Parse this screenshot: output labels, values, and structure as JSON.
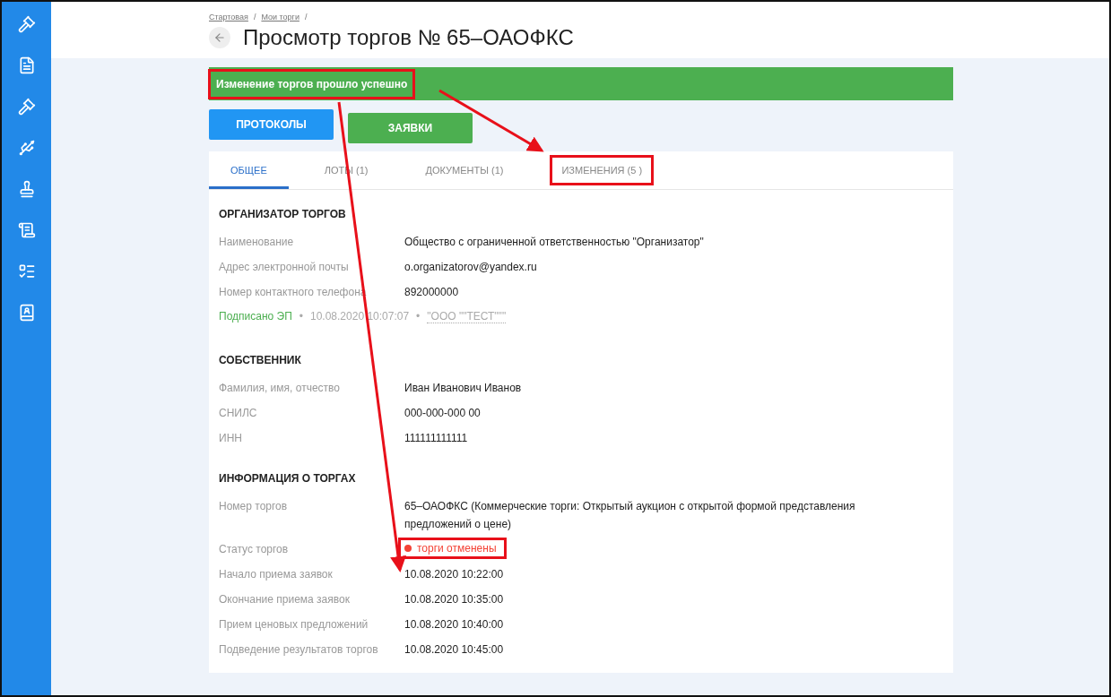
{
  "breadcrumbs": [
    {
      "label": "Стартовая",
      "separator": "/"
    },
    {
      "label": "Мои торги",
      "separator": "/"
    }
  ],
  "title": "Просмотр торгов № 65–ОАОФКС",
  "banner": {
    "text": "Изменение торгов прошло успешно",
    "highlighted": true
  },
  "buttons": [
    {
      "label": "ПРОТОКОЛЫ",
      "kind": "primary"
    },
    {
      "label": "ЗАЯВКИ",
      "kind": "success"
    }
  ],
  "tabs": [
    {
      "label": "ОБЩЕЕ",
      "selected": true,
      "highlighted": false
    },
    {
      "label": "ЛОТЫ (1)",
      "selected": false,
      "highlighted": false
    },
    {
      "label": "ДОКУМЕНТЫ (1)",
      "selected": false,
      "highlighted": false
    },
    {
      "label": "ИЗМЕНЕНИЯ (5 )",
      "selected": false,
      "highlighted": true
    }
  ],
  "sections": [
    {
      "title": "ОРГАНИЗАТОР ТОРГОВ",
      "rows": [
        {
          "kind": "text",
          "label": "Наименование",
          "value": "Общество с ограниченной ответственностью \"Организатор\""
        },
        {
          "kind": "text",
          "label": "Адрес электронной почты",
          "value": "o.organizatorov@yandex.ru"
        },
        {
          "kind": "text",
          "label": "Номер контактного телефона",
          "value": "892000000"
        }
      ],
      "signature": {
        "status": "Подписано ЭП",
        "separator_1": "•",
        "date": "10.08.2020 10:07:07",
        "separator_2": "•",
        "signer": "\"ООО \"\"ТЕСТ\"\"\""
      }
    },
    {
      "title": "СОБСТВЕННИК",
      "rows": [
        {
          "kind": "text",
          "label": "Фамилия, имя, отчество",
          "value": "Иван Иванович Иванов"
        },
        {
          "kind": "text",
          "label": "СНИЛС",
          "value": "000-000-000 00"
        },
        {
          "kind": "text",
          "label": "ИНН",
          "value": "111111111111"
        }
      ]
    },
    {
      "title": "ИНФОРМАЦИЯ О ТОРГАХ",
      "rows": [
        {
          "kind": "text",
          "label": "Номер торгов",
          "value": "65–ОАОФКС (Коммерческие торги: Открытый аукцион с открытой формой представления предложений о цене)"
        },
        {
          "kind": "status",
          "label": "Статус торгов",
          "value": "торги отменены",
          "color": "#f44336",
          "highlighted": true
        },
        {
          "kind": "text",
          "label": "Начало приема заявок",
          "value": "10.08.2020 10:22:00"
        },
        {
          "kind": "text",
          "label": "Окончание приема заявок",
          "value": "10.08.2020 10:35:00"
        },
        {
          "kind": "text",
          "label": "Прием ценовых предложений",
          "value": "10.08.2020 10:40:00"
        },
        {
          "kind": "text",
          "label": "Подведение результатов торгов",
          "value": "10.08.2020 10:45:00"
        }
      ]
    }
  ]
}
